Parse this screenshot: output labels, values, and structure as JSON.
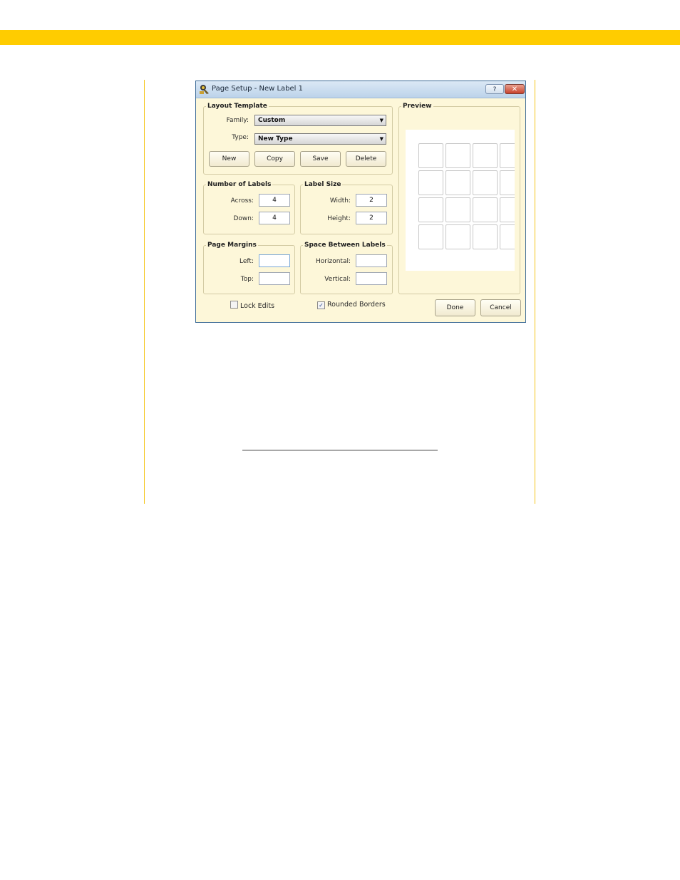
{
  "dialog": {
    "title": "Page Setup - New Label 1",
    "help_label": "?",
    "close_label": "✕"
  },
  "layout_template": {
    "legend": "Layout Template",
    "family_label": "Family:",
    "family_value": "Custom",
    "type_label": "Type:",
    "type_value": "New Type",
    "buttons": {
      "new": "New",
      "copy": "Copy",
      "save": "Save",
      "delete": "Delete"
    }
  },
  "number_of_labels": {
    "legend": "Number of Labels",
    "across_label": "Across:",
    "across_value": "4",
    "down_label": "Down:",
    "down_value": "4"
  },
  "label_size": {
    "legend": "Label Size",
    "width_label": "Width:",
    "width_value": "2",
    "height_label": "Height:",
    "height_value": "2"
  },
  "page_margins": {
    "legend": "Page Margins",
    "left_label": "Left:",
    "left_value": "",
    "top_label": "Top:",
    "top_value": ""
  },
  "space_between": {
    "legend": "Space Between Labels",
    "horizontal_label": "Horizontal:",
    "horizontal_value": "",
    "vertical_label": "Vertical:",
    "vertical_value": ""
  },
  "preview": {
    "legend": "Preview",
    "rows": 4,
    "columns": 4
  },
  "options": {
    "lock_edits_label": "Lock Edits",
    "lock_edits_checked": false,
    "rounded_borders_label": "Rounded Borders",
    "rounded_borders_checked": true,
    "check_mark": "✓"
  },
  "footer": {
    "done_label": "Done",
    "cancel_label": "Cancel"
  },
  "colors": {
    "accent_bar": "#ffcc00",
    "dialog_bg": "#fdf7d9",
    "title_bar": "#bcd3ea"
  }
}
